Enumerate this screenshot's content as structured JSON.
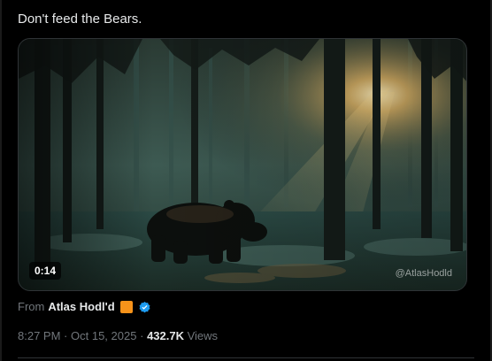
{
  "tweet": {
    "text": "Don't feed the Bears."
  },
  "media": {
    "duration": "0:14",
    "watermark": "@AtlasHodld",
    "description": "bear-in-misty-forest"
  },
  "attribution": {
    "from_label": "From",
    "source_name": "Atlas Hodl'd"
  },
  "meta": {
    "time": "8:27 PM",
    "separator1": "·",
    "date": "Oct 15, 2025",
    "separator2": "·",
    "views_count": "432.7K",
    "views_label": "Views"
  },
  "colors": {
    "background": "#000000",
    "text_primary": "#e7e9ea",
    "text_secondary": "#71767b",
    "verified_blue": "#1d9bf0",
    "badge_orange": "#f7931a"
  }
}
